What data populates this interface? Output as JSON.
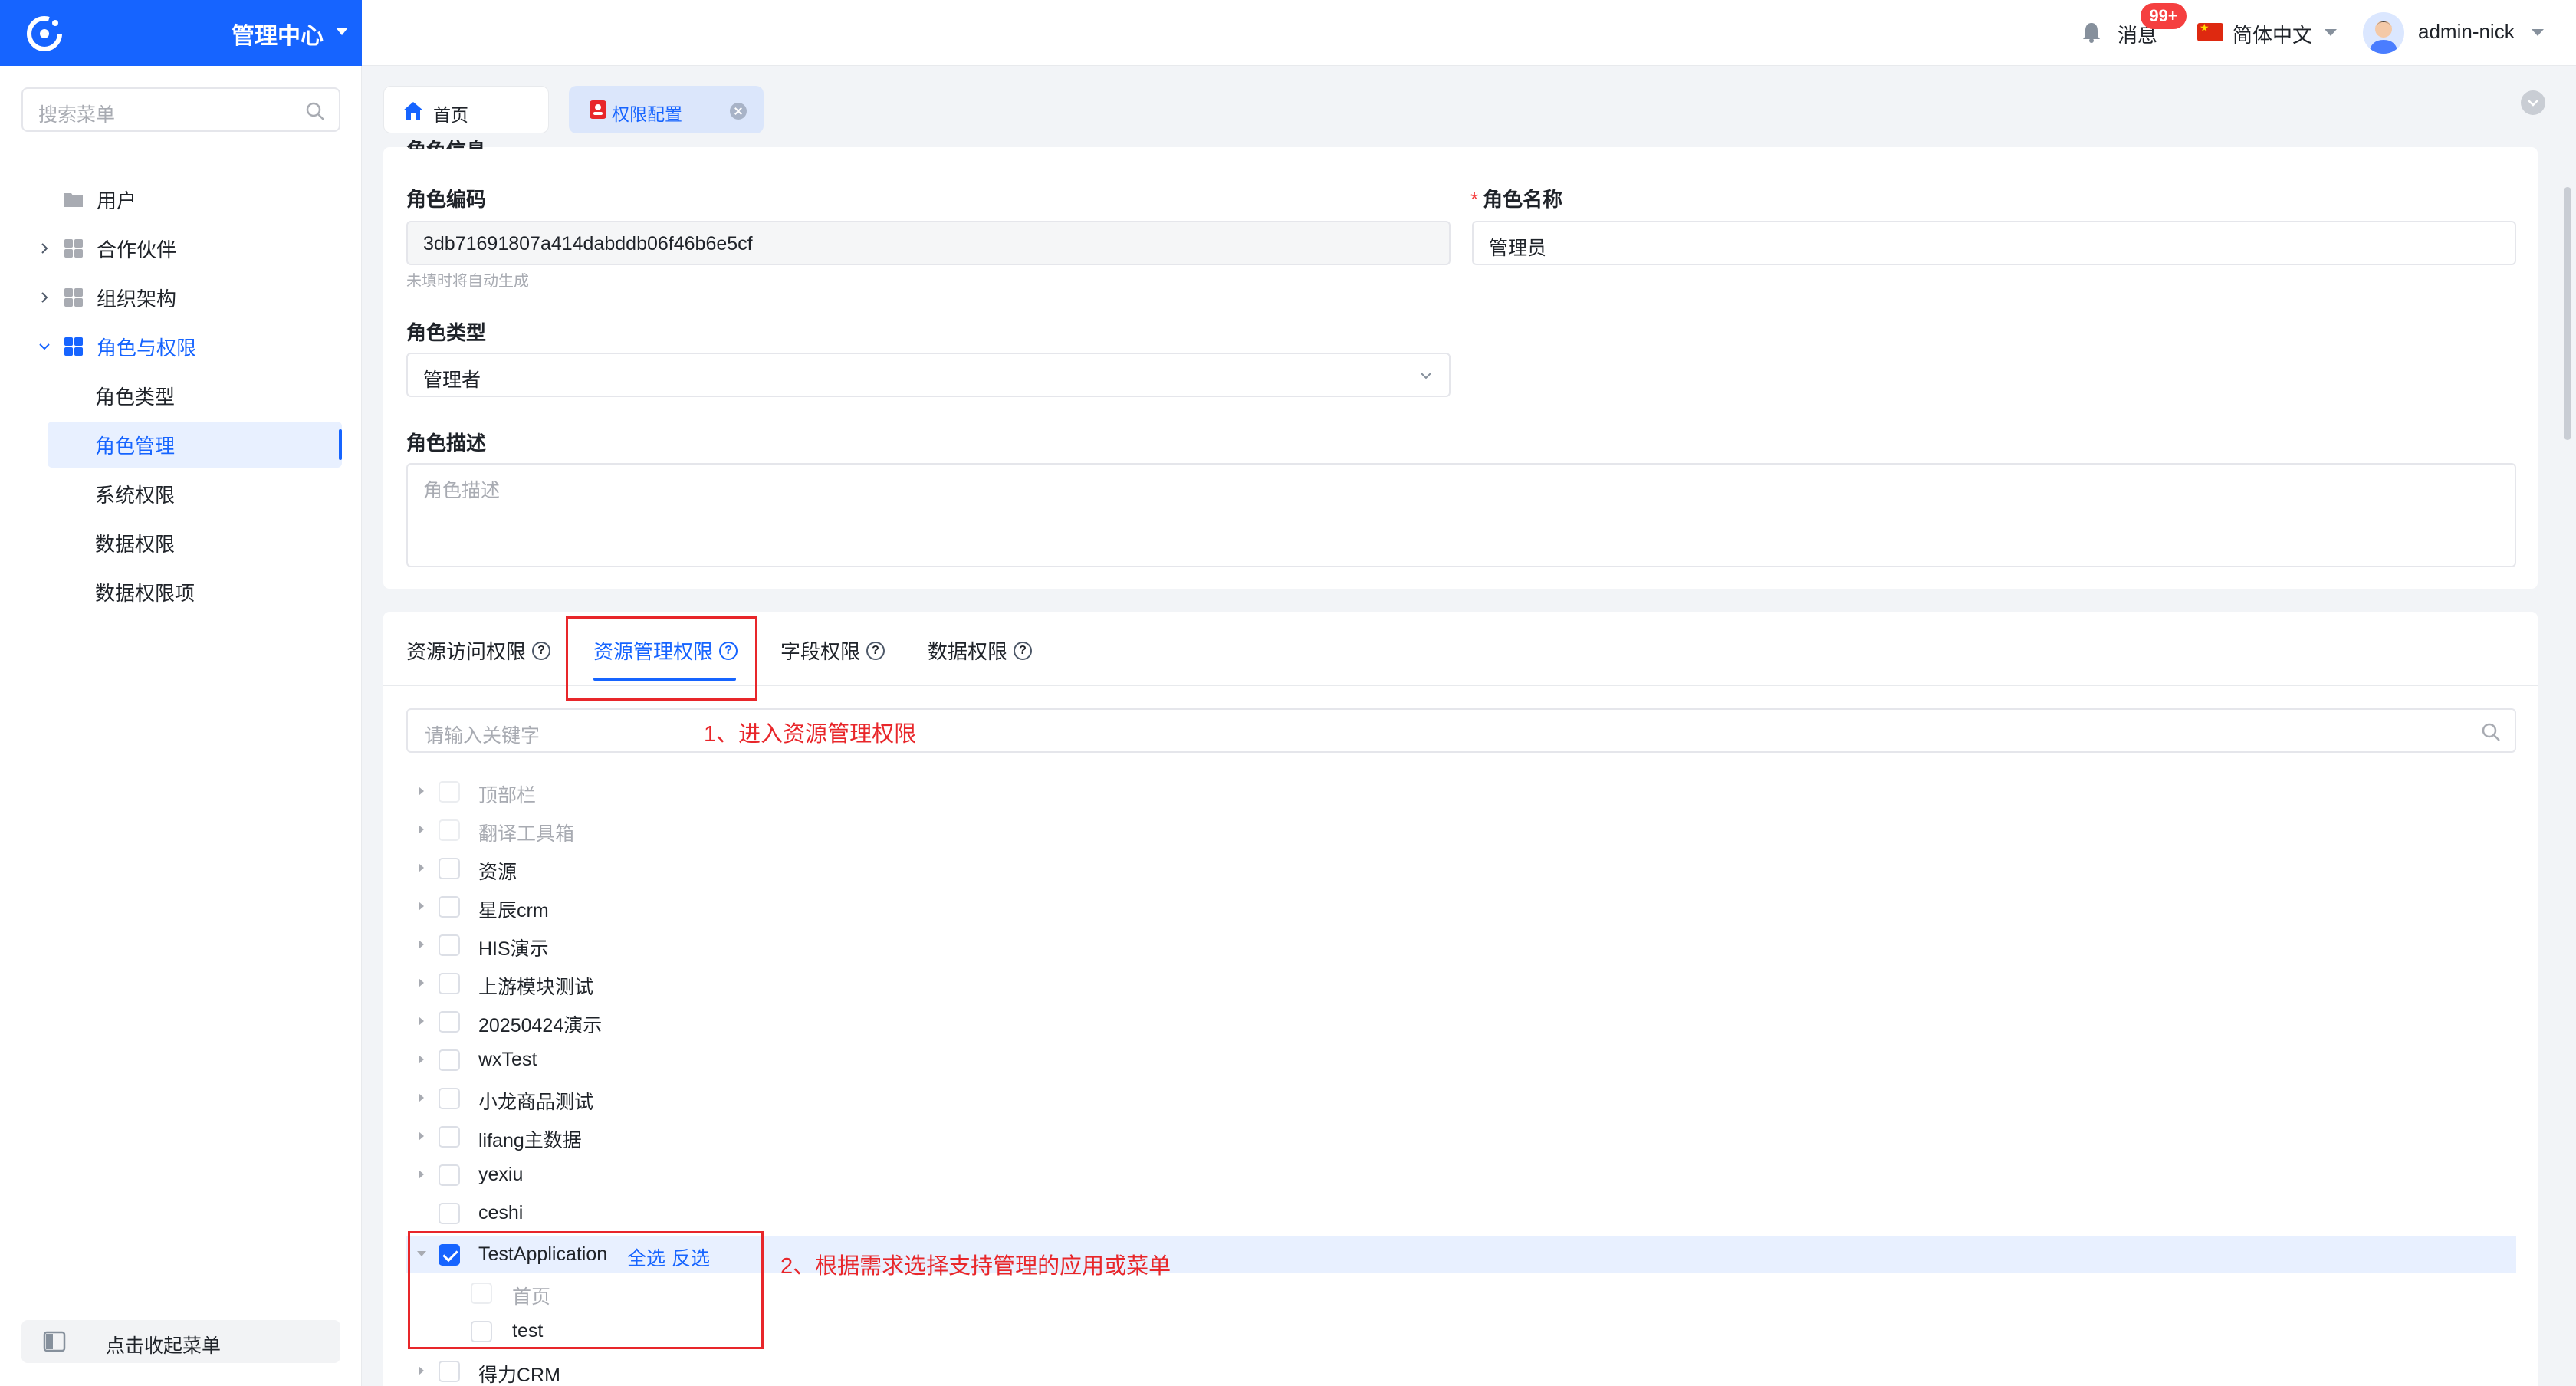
{
  "header": {
    "brand_title": "管理中心",
    "messages_label": "消息",
    "messages_badge": "99+",
    "language_label": "简体中文",
    "user_name": "admin-nick"
  },
  "sidebar": {
    "search_placeholder": "搜索菜单",
    "items": [
      {
        "label": "用户"
      },
      {
        "label": "合作伙伴"
      },
      {
        "label": "组织架构"
      },
      {
        "label": "角色与权限"
      },
      {
        "label": "角色类型"
      },
      {
        "label": "角色管理"
      },
      {
        "label": "系统权限"
      },
      {
        "label": "数据权限"
      },
      {
        "label": "数据权限项"
      }
    ],
    "collapse_label": "点击收起菜单"
  },
  "tabs": [
    {
      "label": "首页"
    },
    {
      "label": "权限配置"
    }
  ],
  "basic": {
    "section_title_partial": "角色信息",
    "code_label": "角色编码",
    "code_value": "3db71691807a414dabddb06f46b6e5cf",
    "code_hint": "未填时将自动生成",
    "name_label": "角色名称",
    "name_value": "管理员",
    "type_label": "角色类型",
    "type_value": "管理者",
    "desc_label": "角色描述",
    "desc_placeholder": "角色描述"
  },
  "perm_tabs": [
    {
      "label": "资源访问权限"
    },
    {
      "label": "资源管理权限"
    },
    {
      "label": "字段权限"
    },
    {
      "label": "数据权限"
    }
  ],
  "keyword_placeholder": "请输入关键字",
  "annotations": {
    "step1": "1、进入资源管理权限",
    "step2": "2、根据需求选择支持管理的应用或菜单"
  },
  "tree": [
    {
      "label": "顶部栏"
    },
    {
      "label": "翻译工具箱"
    },
    {
      "label": "资源"
    },
    {
      "label": "星辰crm"
    },
    {
      "label": "HIS演示"
    },
    {
      "label": "上游模块测试"
    },
    {
      "label": "20250424演示"
    },
    {
      "label": "wxTest"
    },
    {
      "label": "小龙商品测试"
    },
    {
      "label": "lifang主数据"
    },
    {
      "label": "yexiu"
    },
    {
      "label": "ceshi"
    },
    {
      "label": "TestApplication",
      "select_all": "全选",
      "invert": "反选"
    },
    {
      "label": "首页"
    },
    {
      "label": "test"
    },
    {
      "label": "得力CRM"
    }
  ],
  "colors": {
    "primary": "#1664ff",
    "annotation": "#e8262a"
  }
}
